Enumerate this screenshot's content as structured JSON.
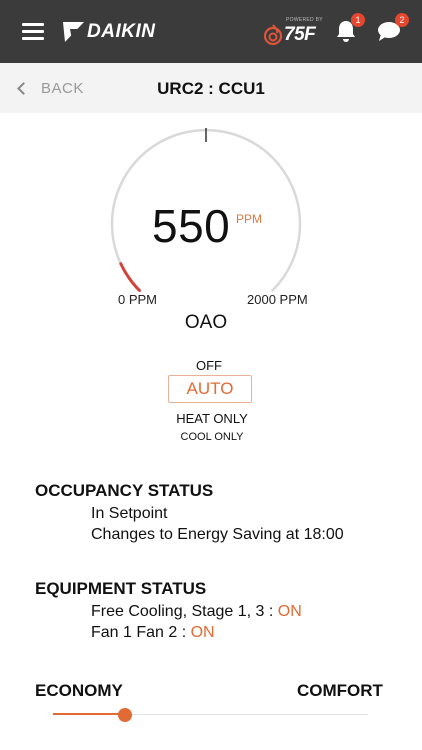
{
  "header": {
    "brand": "DAIKIN",
    "powered_by": "POWERED BY",
    "powered_logo": "75F",
    "notifications_count": "1",
    "messages_count": "2",
    "icons": [
      "menu-icon",
      "daikin-logo",
      "75f-flame-logo",
      "bell-icon",
      "chat-icon"
    ],
    "bar_color": "#3b3b3b"
  },
  "nav": {
    "back_label": "BACK",
    "title": "URC2 : CCU1"
  },
  "gauge": {
    "value": "550",
    "unit": "PPM",
    "min_label": "0 PPM",
    "max_label": "2000 PPM",
    "min": 0,
    "max": 2000,
    "setpoint_fraction": 0.5,
    "sensor": "OAO",
    "accent_color": "#d0443a"
  },
  "modes": {
    "off": "OFF",
    "auto": "AUTO",
    "heat_only": "HEAT ONLY",
    "cool_only": "COOL ONLY",
    "selected": "AUTO"
  },
  "occupancy": {
    "title": "OCCUPANCY STATUS",
    "line1": "In Setpoint",
    "line2": "Changes to Energy Saving at 18:00"
  },
  "equipment": {
    "title": "EQUIPMENT STATUS",
    "line1_label": "Free Cooling, Stage 1, 3 : ",
    "line1_state": "ON",
    "line2_label": "Fan 1 Fan 2 : ",
    "line2_state": "ON"
  },
  "slider": {
    "left_label": "ECONOMY",
    "right_label": "COMFORT",
    "value_fraction": 0.23,
    "accent_color": "#e26a34"
  }
}
